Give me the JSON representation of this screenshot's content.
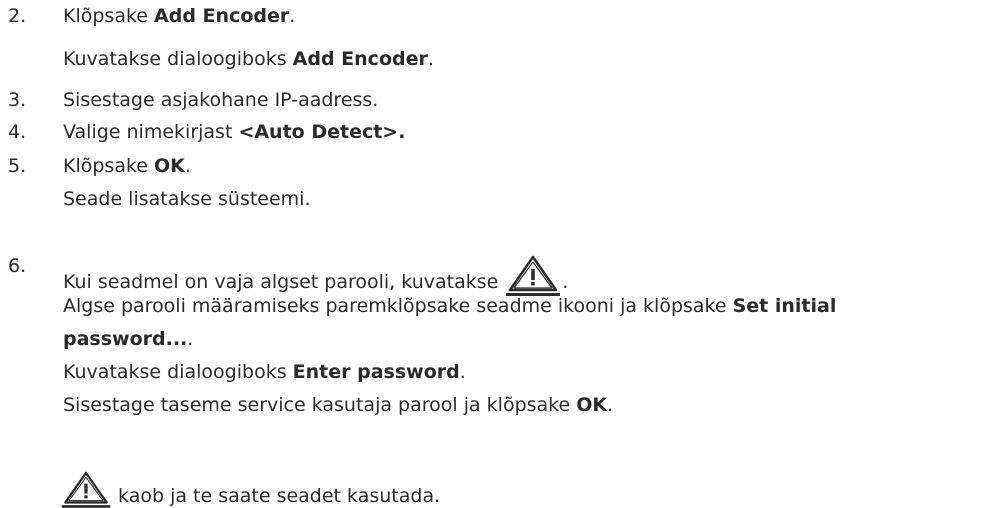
{
  "steps": [
    {
      "num": "2.",
      "text_pre": "Klõpsake ",
      "bold": "Add Encoder",
      "text_post": ".",
      "note_pre": "Kuvatakse dialoogiboks ",
      "note_bold": "Add Encoder",
      "note_post": "."
    },
    {
      "num": "3.",
      "text": "Sisestage asjakohane IP-aadress."
    },
    {
      "num": "4.",
      "text_pre": "Valige nimekirjast ",
      "bold": "<Auto Detect>."
    },
    {
      "num": "5.",
      "text_pre": "Klõpsake ",
      "bold": "OK",
      "text_post": ".",
      "note": "Seade lisatakse süsteemi."
    },
    {
      "num": "6.",
      "text_pre": "Kui seadmel on vaja algset parooli, kuvatakse ",
      "text_post": ".",
      "line2_pre": "Algse parooli määramiseks paremklõpsake seadme ikooni ja klõpsake ",
      "line2_bold": "Set initial",
      "line3_bold": "password...",
      "line3_post": ".",
      "line4_pre": "Kuvatakse dialoogiboks ",
      "line4_bold": "Enter password",
      "line4_post": ".",
      "line5_pre": "Sisestage taseme service kasutaja parool ja klõpsake ",
      "line5_bold": "OK",
      "line5_post": ".",
      "line6_post": " kaob ja te saate seadet kasutada."
    }
  ],
  "icons": {
    "warning": "warning-triangle-icon"
  },
  "colors": {
    "text": "#2b2b2b"
  }
}
